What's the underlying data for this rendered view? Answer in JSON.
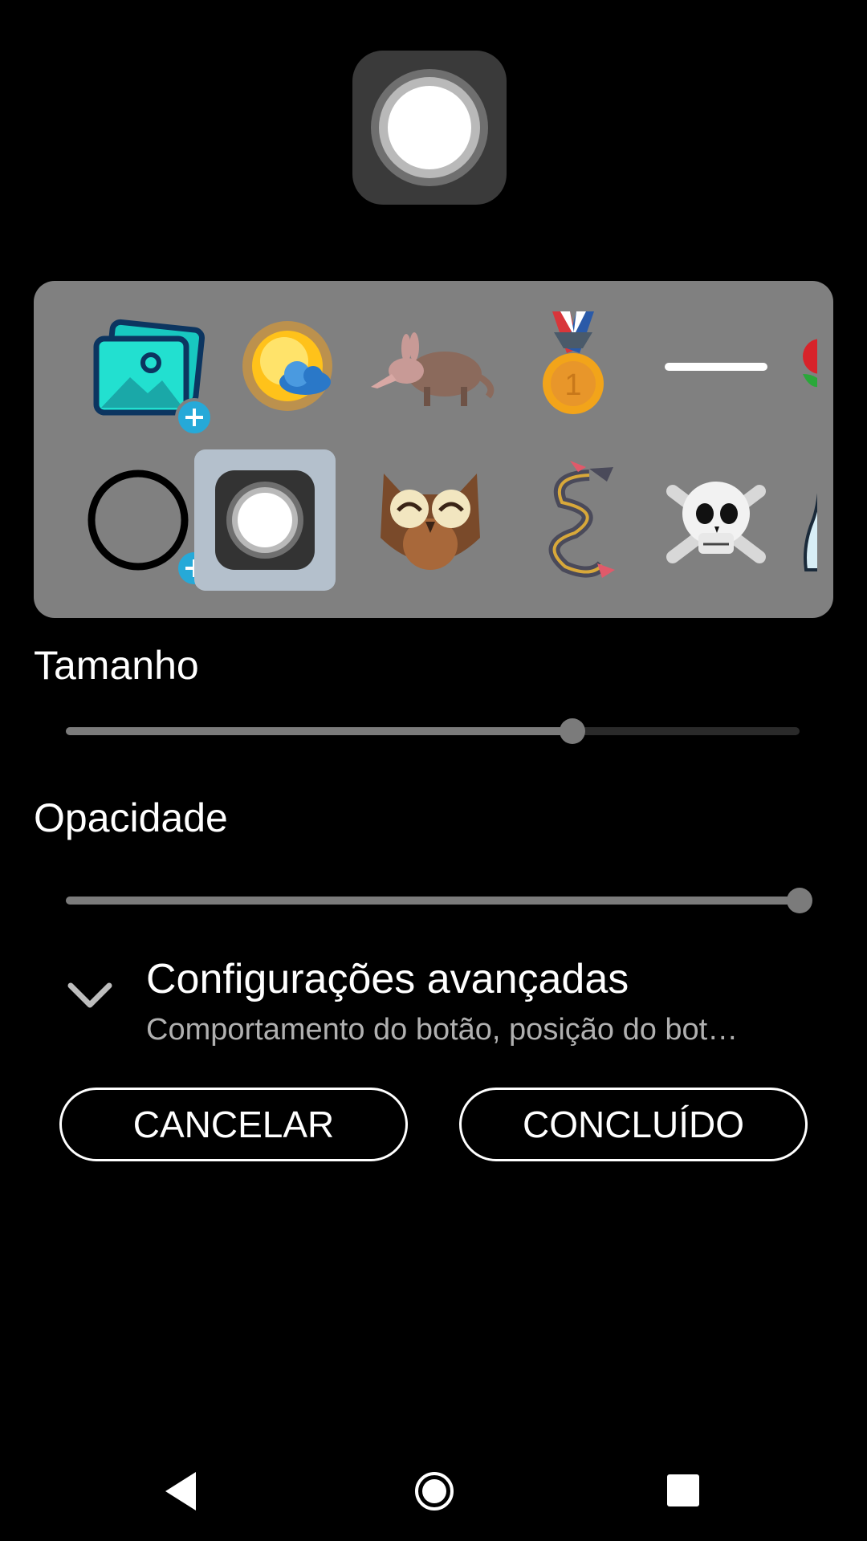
{
  "palette": {
    "row1": [
      "picture-add-icon",
      "sun-cloud-icon",
      "aardvark-icon",
      "medal-icon",
      "line-icon",
      "rose-icon"
    ],
    "row2": [
      "circle-outline-add-icon",
      "assistive-button-icon",
      "owl-icon",
      "dragon-icon",
      "skull-icon",
      "bottle-icon"
    ],
    "selected": "assistive-button-icon"
  },
  "size": {
    "label": "Tamanho",
    "value_fraction": 0.69
  },
  "opacity": {
    "label": "Opacidade",
    "value_fraction": 1.0
  },
  "advanced": {
    "title": "Configurações avançadas",
    "subtitle": "Comportamento do botão, posição do bot…"
  },
  "buttons": {
    "cancel": "CANCELAR",
    "done": "CONCLUÍDO"
  },
  "colors": {
    "background": "#000000",
    "palette_bg": "#808080",
    "selected_bg": "#b4c0cc",
    "accent_plus": "#26a9d8"
  }
}
